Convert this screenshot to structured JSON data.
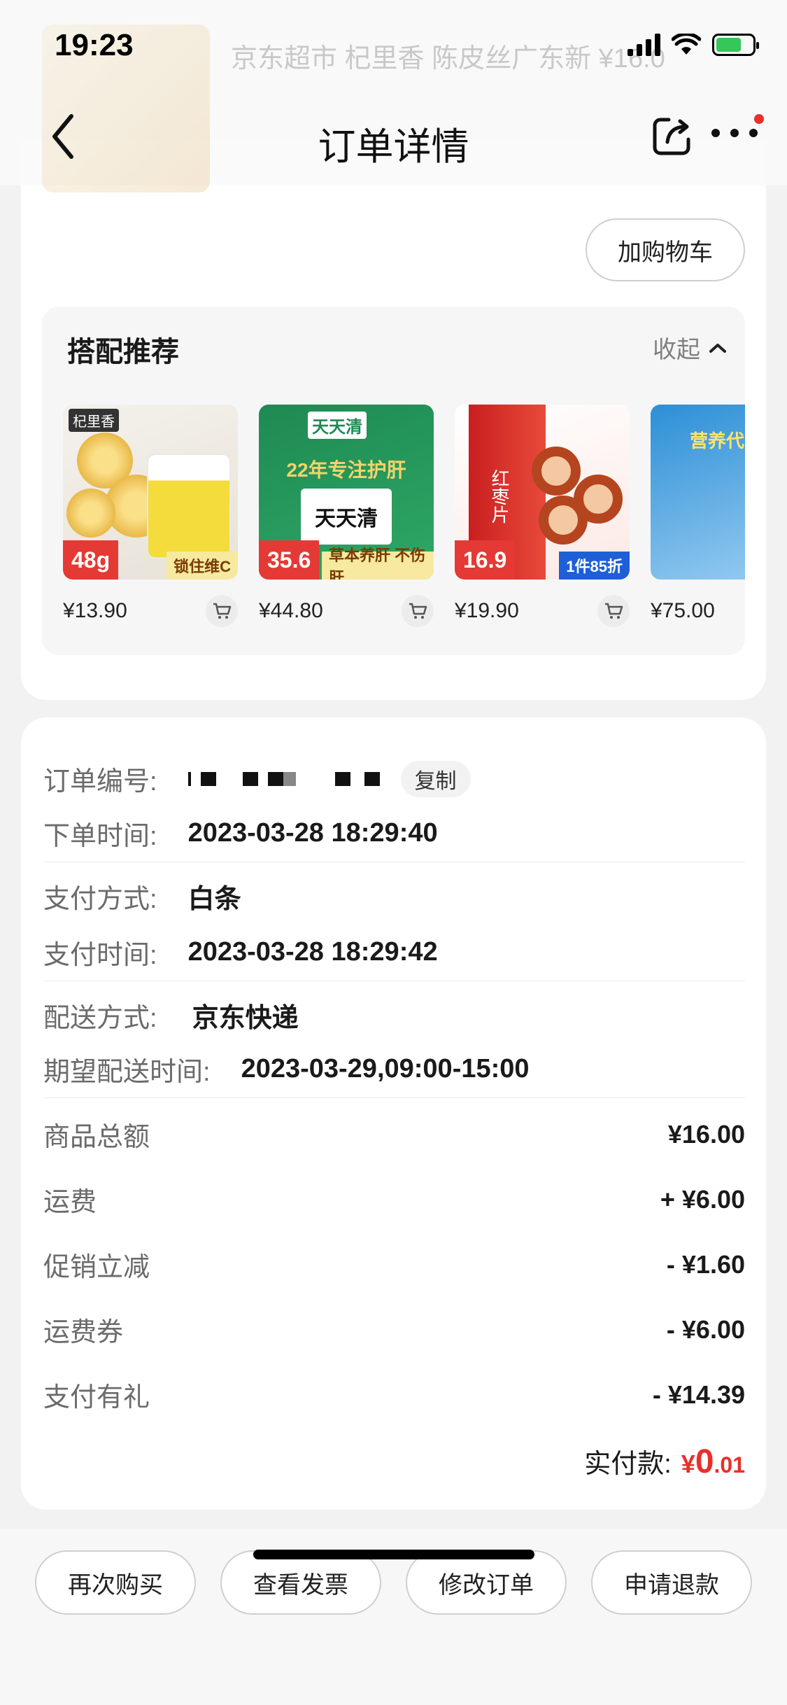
{
  "status_bar": {
    "time": "19:23"
  },
  "peek_header": {
    "text": "京东超市 杞里香 陈皮丝广东新 ¥16.0"
  },
  "nav": {
    "title": "订单详情"
  },
  "product": {
    "add_to_cart_label": "加购物车"
  },
  "recommend": {
    "title": "搭配推荐",
    "collapse_label": "收起",
    "items": [
      {
        "price": "¥13.90",
        "image_badge": "48g",
        "image_strip": "锁住维C",
        "image_logo": "杞里香"
      },
      {
        "price": "¥44.80",
        "image_badge": "35.6",
        "image_strip": "草本养肝 不伤肝",
        "image_head": "22年专注护肝",
        "image_logo": "天天清"
      },
      {
        "price": "¥19.90",
        "image_badge": "16.9",
        "image_strip": "1件85折",
        "image_logo": "红枣片"
      },
      {
        "price": "¥75.00",
        "image_logo": "营养代"
      }
    ]
  },
  "order": {
    "number_label": "订单编号:",
    "copy_label": "复制",
    "order_time_label": "下单时间:",
    "order_time": "2023-03-28 18:29:40",
    "payment_method_label": "支付方式:",
    "payment_method": "白条",
    "payment_time_label": "支付时间:",
    "payment_time": "2023-03-28 18:29:42",
    "delivery_method_label": "配送方式:",
    "delivery_method": "京东快递",
    "expected_delivery_label": "期望配送时间:",
    "expected_delivery": "2023-03-29,09:00-15:00"
  },
  "amounts": [
    {
      "label": "商品总额",
      "value": "¥16.00"
    },
    {
      "label": "运费",
      "value": "+ ¥6.00"
    },
    {
      "label": "促销立减",
      "value": "- ¥1.60"
    },
    {
      "label": "运费券",
      "value": "- ¥6.00"
    },
    {
      "label": "支付有礼",
      "value": "- ¥14.39"
    }
  ],
  "total": {
    "label": "实付款:",
    "yen": "¥",
    "integer": "0",
    "decimal": ".01"
  },
  "actions": {
    "buy_again": "再次购买",
    "view_invoice": "查看发票",
    "modify_order": "修改订单",
    "apply_refund": "申请退款"
  },
  "colors": {
    "accent_red": "#e8302a",
    "battery_green": "#35c759"
  }
}
